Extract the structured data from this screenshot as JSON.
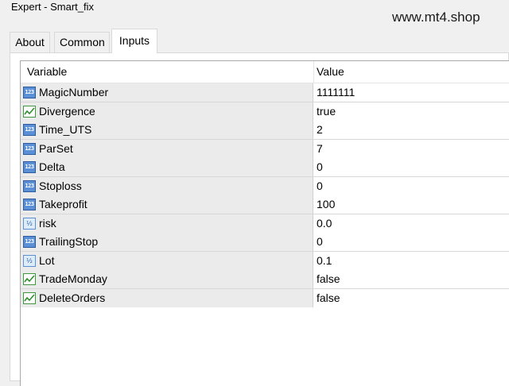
{
  "window": {
    "title": "Expert - Smart_fix"
  },
  "watermark": "www.mt4.shop",
  "tabs": [
    {
      "label": "About"
    },
    {
      "label": "Common"
    },
    {
      "label": "Inputs"
    }
  ],
  "active_tab": "Inputs",
  "grid": {
    "columns": {
      "variable": "Variable",
      "value": "Value"
    },
    "rows": [
      {
        "name": "MagicNumber",
        "value": "1111111",
        "type": "int",
        "icon": "integer-icon"
      },
      {
        "name": "Divergence",
        "value": "true",
        "type": "bool",
        "icon": "boolean-icon"
      },
      {
        "name": "Time_UTS",
        "value": "2",
        "type": "int",
        "icon": "integer-icon"
      },
      {
        "name": "ParSet",
        "value": "7",
        "type": "int",
        "icon": "integer-icon"
      },
      {
        "name": "Delta",
        "value": "0",
        "type": "int",
        "icon": "integer-icon"
      },
      {
        "name": "Stoploss",
        "value": "0",
        "type": "int",
        "icon": "integer-icon"
      },
      {
        "name": "Takeprofit",
        "value": "100",
        "type": "int",
        "icon": "integer-icon"
      },
      {
        "name": "risk",
        "value": "0.0",
        "type": "double",
        "icon": "double-icon"
      },
      {
        "name": "TrailingStop",
        "value": "0",
        "type": "int",
        "icon": "integer-icon"
      },
      {
        "name": "Lot",
        "value": "0.1",
        "type": "double",
        "icon": "double-icon"
      },
      {
        "name": "TradeMonday",
        "value": "false",
        "type": "bool",
        "icon": "boolean-icon"
      },
      {
        "name": "DeleteOrders",
        "value": "false",
        "type": "bool",
        "icon": "boolean-icon"
      }
    ]
  },
  "colors": {
    "name_cell_bg": "#ebebeb",
    "int_icon": "#5b8fd6",
    "bool_icon": "#3c9a3c"
  }
}
